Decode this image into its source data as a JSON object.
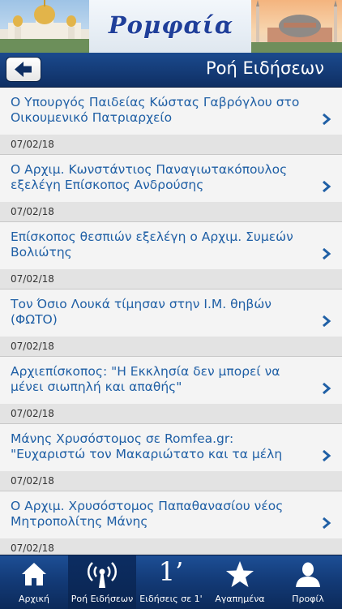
{
  "banner": {
    "logo_text": "Ρομφαία"
  },
  "header": {
    "title": "Ροή Ειδήσεων"
  },
  "news": [
    {
      "title": "Ο Υπουργός Παιδείας Κώστας Γαβρόγλου στο Οικουμενικό Πατριαρχείο",
      "date": "07/02/18"
    },
    {
      "title": "Ο Αρχιμ. Κωνστάντιος Παναγιωτακόπουλος εξελέγη Επίσκοπος Ανδρούσης",
      "date": "07/02/18"
    },
    {
      "title": "Επίσκοπος θεσπιών εξελέγη ο Αρχιμ. Συμεών Βολιώτης",
      "date": "07/02/18"
    },
    {
      "title": "Τον Όσιο Λουκά τίμησαν στην Ι.Μ. θηβών (ΦΩΤΟ)",
      "date": "07/02/18"
    },
    {
      "title": "Αρχιεπίσκοπος: \"Η Εκκλησία δεν μπορεί να μένει σιωπηλή και απαθής\"",
      "date": "07/02/18"
    },
    {
      "title": "Μάνης Χρυσόστομος σε Romfea.gr: \"Ευχαριστώ τον Μακαριώτατο και τα μέλη",
      "date": "07/02/18"
    },
    {
      "title": "Ο Αρχιμ. Χρυσόστομος Παπαθανασίου νέος Μητροπολίτης Μάνης",
      "date": "07/02/18"
    }
  ],
  "tabs": [
    {
      "label": "Αρχική",
      "icon": "home-icon"
    },
    {
      "label": "Ροή Ειδήσεων",
      "icon": "broadcast-icon",
      "active": true
    },
    {
      "label": "Ειδήσεις σε 1'",
      "icon": "one-minute-icon",
      "glyph": "1’"
    },
    {
      "label": "Αγαπημένα",
      "icon": "star-icon"
    },
    {
      "label": "Προφίλ",
      "icon": "profile-icon"
    }
  ],
  "colors": {
    "header_bg": "#14397a",
    "title_text": "#1f5fa5",
    "chevron": "#1f5fa5"
  }
}
